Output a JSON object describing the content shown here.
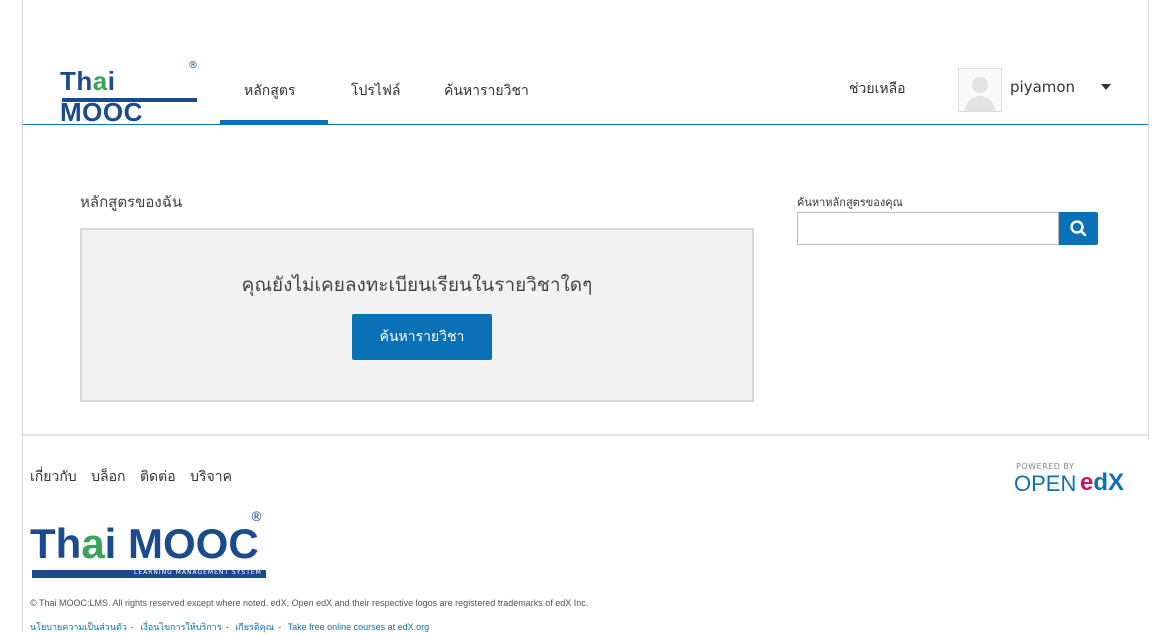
{
  "header": {
    "logo_text": "Thai MOOC",
    "nav": [
      {
        "label": "หลักสูตร",
        "active": true
      },
      {
        "label": "โปรไฟล์",
        "active": false
      },
      {
        "label": "ค้นหารายวิชา",
        "active": false
      }
    ],
    "help_label": "ช่วยเหลือ",
    "username": "piyamon"
  },
  "main": {
    "my_courses_title": "หลักสูตรของฉัน",
    "empty_message": "คุณยังไม่เคยลงทะเบียนเรียนในรายวิชาใดๆ",
    "find_courses_button": "ค้นหารายวิชา",
    "search_label": "ค้นหาหลักสูตรของคุณ",
    "search_value": ""
  },
  "footer": {
    "links": [
      "เกี่ยวกับ",
      "บล็อก",
      "ติดต่อ",
      "บริจาค"
    ],
    "powered_by": "POWERED BY",
    "openedx_open": "OPEN",
    "openedx_edx": "edX",
    "logo_text": "Thai MOOC",
    "logo_subtitle": "LEARNING MANAGEMENT SYSTEM",
    "copyright": "© Thai MOOC:LMS. All rights reserved except where noted. edX, Open edX and their respective logos are registered trademarks of edX Inc.",
    "legal": [
      "นโยบายความเป็นส่วนตัว",
      "เงื่อนไขการให้บริการ",
      "เกียรติคุณ",
      "Take free online courses at edX.org"
    ]
  },
  "colors": {
    "accent": "#0b71b6",
    "logo_blue": "#1c4a8e",
    "logo_green": "#3aa35b",
    "edx_pink": "#c4185b"
  }
}
